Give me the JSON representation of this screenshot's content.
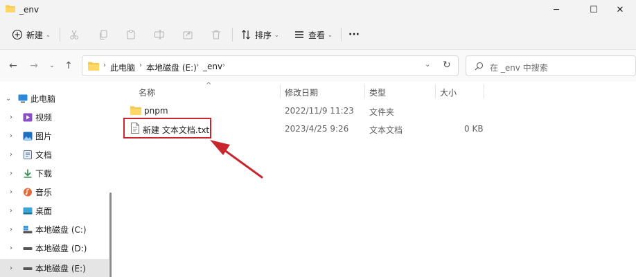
{
  "window": {
    "title": "_env",
    "minimize": "─",
    "maximize": "☐",
    "close": "✕"
  },
  "toolbar": {
    "new_label": "新建",
    "sort_label": "排序",
    "view_label": "查看",
    "more_label": "···"
  },
  "address": {
    "crumbs": [
      "此电脑",
      "本地磁盘 (E:)",
      "_env"
    ],
    "search_placeholder": "在 _env 中搜索"
  },
  "sidebar": {
    "items": [
      {
        "label": "此电脑",
        "icon": "monitor-icon",
        "expanded": true
      },
      {
        "label": "视频",
        "icon": "video-icon"
      },
      {
        "label": "图片",
        "icon": "picture-icon"
      },
      {
        "label": "文档",
        "icon": "document-icon"
      },
      {
        "label": "下载",
        "icon": "download-icon"
      },
      {
        "label": "音乐",
        "icon": "music-icon"
      },
      {
        "label": "桌面",
        "icon": "desktop-icon"
      },
      {
        "label": "本地磁盘 (C:)",
        "icon": "drive-icon"
      },
      {
        "label": "本地磁盘 (D:)",
        "icon": "drive-icon"
      },
      {
        "label": "本地磁盘 (E:)",
        "icon": "drive-icon",
        "selected": true
      }
    ]
  },
  "columns": {
    "name": "名称",
    "modified": "修改日期",
    "type": "类型",
    "size": "大小"
  },
  "files": [
    {
      "name": "pnpm",
      "modified": "2022/11/9 11:23",
      "type": "文件夹",
      "size": "",
      "icon": "folder-icon"
    },
    {
      "name": "新建 文本文档.txt",
      "modified": "2023/4/25 9:26",
      "type": "文本文档",
      "size": "0 KB",
      "icon": "text-file-icon"
    }
  ],
  "colors": {
    "accent": "#0067c0",
    "folder": "#f6c84b",
    "annotation": "#c8252c",
    "selection": "#e5e5e5"
  }
}
